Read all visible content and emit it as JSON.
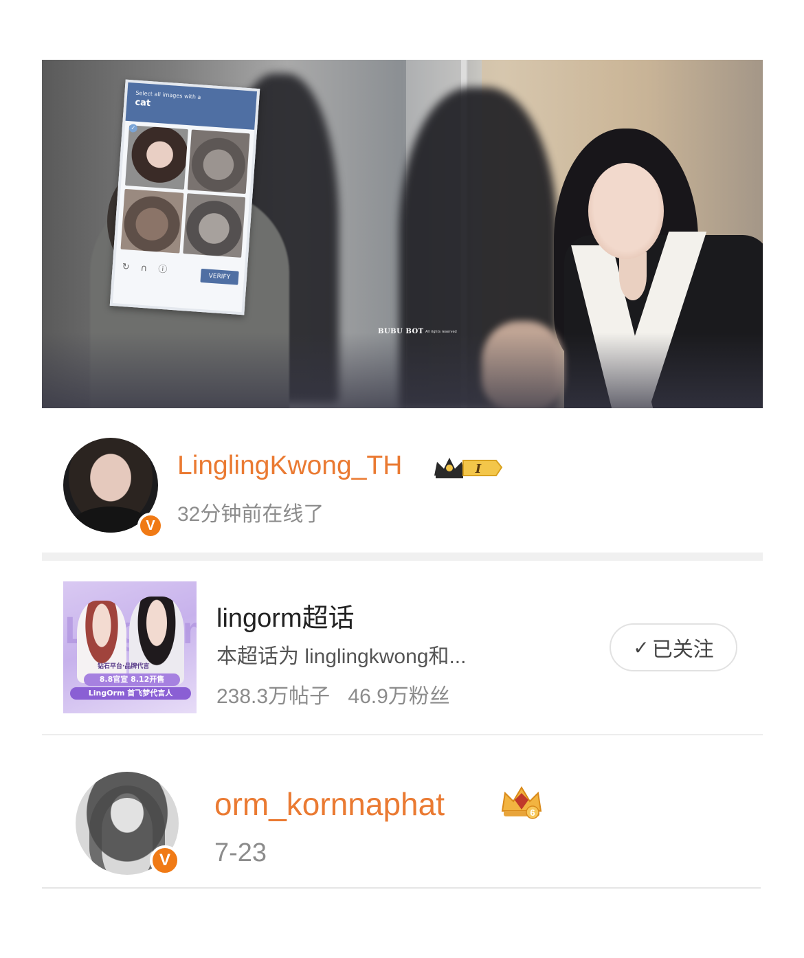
{
  "photo": {
    "captcha": {
      "prompt": "Select all images with a",
      "target": "cat",
      "verify_label": "VERIFY",
      "icons": "↻ ∩ ⓘ"
    },
    "watermark": "BUBU BOT",
    "watermark_rights": "All rights reserved"
  },
  "items": [
    {
      "type": "user",
      "username": "LinglingKwong_TH",
      "status": "32分钟前在线了",
      "verified_label": "V",
      "level_badge": "I",
      "crown_icon": "crown-level-icon"
    },
    {
      "type": "supertopic",
      "title": "lingorm超话",
      "description": "本超话为 linglingkwong和...",
      "posts": "238.3万帖子",
      "fans": "46.9万粉丝",
      "follow_label": "已关注",
      "follow_icon": "✓",
      "cover": {
        "big_text": "LingOrm",
        "top_text": "钻石平台·品牌代言",
        "pill1": "8.8官宣 8.12开售",
        "pill2": "LingOrm 首飞梦代言人"
      }
    },
    {
      "type": "user",
      "username": "orm_kornnaphat",
      "status": "7-23",
      "verified_label": "V",
      "level_badge": "6",
      "crown_icon": "diamond-crown-icon"
    }
  ],
  "colors": {
    "username": "#ea7a32",
    "verified": "#f07a15",
    "secondary_text": "#8c8c8c"
  }
}
